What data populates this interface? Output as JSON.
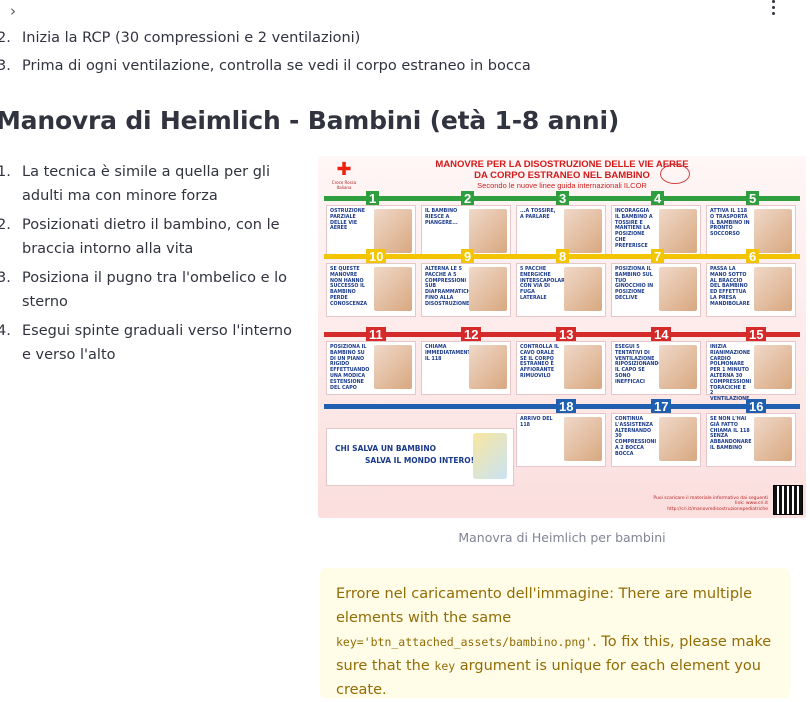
{
  "top_list": [
    {
      "num": "2.",
      "text": "Inizia la RCP (30 compressioni e 2 ventilazioni)"
    },
    {
      "num": "3.",
      "text": "Prima di ogni ventilazione, controlla se vedi il corpo estraneo in bocca"
    }
  ],
  "section_title": "Manovra di Heimlich - Bambini (età 1-8 anni)",
  "steps": [
    {
      "num": "1.",
      "text": "La tecnica è simile a quella per gli adulti ma con minore forza"
    },
    {
      "num": "2.",
      "text": "Posizionati dietro il bambino, con le braccia intorno alla vita"
    },
    {
      "num": "3.",
      "text": "Posiziona il pugno tra l'ombelico e lo sterno"
    },
    {
      "num": "4.",
      "text": "Esegui spinte graduali verso l'interno e verso l'alto"
    }
  ],
  "figure": {
    "title_line1": "MANOVRE PER LA DISOSTRUZIONE DELLE VIE AEREE",
    "title_line2": "DA CORPO ESTRANEO NEL BAMBINO",
    "subtitle": "Secondo le nuove linee guida internazionali ILCOR",
    "org": "Croce Rossa Italiana",
    "panels": [
      {
        "n": "1",
        "text": "Ostruzione parziale delle vie aeree"
      },
      {
        "n": "2",
        "text": "Il bambino riesce a piangere..."
      },
      {
        "n": "3",
        "text": "...a tossire, a parlare"
      },
      {
        "n": "4",
        "text": "Incoraggia il bambino a tossire e mantieni la posizione che preferisce"
      },
      {
        "n": "5",
        "text": "Attiva il 118 o trasporta il bambino in pronto soccorso"
      },
      {
        "n": "10",
        "text": "Se queste manovre non hanno successo il bambino perde conoscenza"
      },
      {
        "n": "9",
        "text": "Alterna le 5 pacche a 5 compressioni sub diaframmatiche fino alla disostruzione"
      },
      {
        "n": "8",
        "text": "5 pacche energiche interscapolari con via di fuga laterale"
      },
      {
        "n": "7",
        "text": "Posiziona il bambino sul tuo ginocchio in posizione declive"
      },
      {
        "n": "6",
        "text": "Passa la mano sotto al braccio del bambino ed effettua la presa mandibolare"
      },
      {
        "n": "11",
        "text": "Posiziona il bambino su di un piano rigido effettuando una modica estensione del capo"
      },
      {
        "n": "12",
        "text": "Chiama immediatamente il 118"
      },
      {
        "n": "13",
        "text": "Controlla il cavo orale se il corpo estraneo è affiorante rimuovilo"
      },
      {
        "n": "14",
        "text": "Esegui 5 tentativi di ventilazione riposizionando il capo se sono inefficaci"
      },
      {
        "n": "15",
        "text": "Inizia rianimazione cardio polmonare per 1 minuto alterna 30 compressioni toraciche e 2 ventilazione"
      },
      {
        "n": "18",
        "text": "Arrivo del 118"
      },
      {
        "n": "17",
        "text": "Continua l'assistenza alternando 30 compressioni a 2 bocca bocca"
      },
      {
        "n": "16",
        "text": "Se non l'hai già fatto chiama il 118 senza abbandonare il bambino"
      }
    ],
    "slogan_line1": "CHI SALVA UN BAMBINO",
    "slogan_line2": "SALVA IL MONDO INTERO!!",
    "footer": "Puoi scaricare il materiale informativo dai seguenti link: www.cri.it http://cri.it/manovredisostruzionepediatriche"
  },
  "caption": "Manovra di Heimlich per bambini",
  "alert": {
    "prefix": "Errore nel caricamento dell'immagine: There are multiple elements with the same ",
    "code1": "key='btn_attached_assets/bambino.png'",
    "middle": ". To fix this, please make sure that the ",
    "code2": "key",
    "suffix": " argument is unique for each element you create."
  },
  "colors": {
    "text": "#31333f",
    "alert_bg": "#fffce7",
    "alert_text": "#926c05",
    "caption": "#808495"
  }
}
